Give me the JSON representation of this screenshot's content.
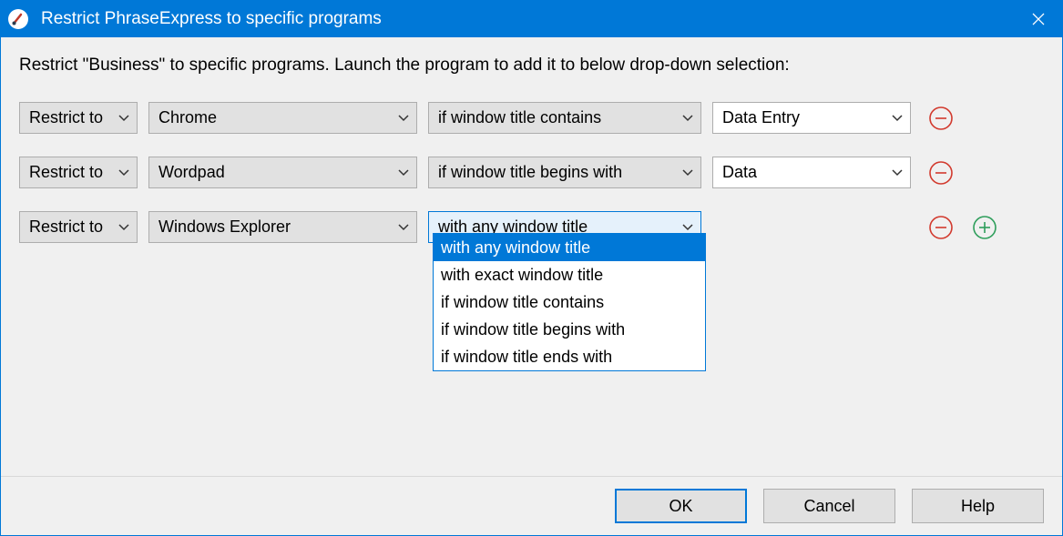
{
  "title": "Restrict PhraseExpress to specific programs",
  "instruction": "Restrict \"Business\" to specific programs. Launch the program to add it to below drop-down selection:",
  "rows": [
    {
      "action": "Restrict to",
      "program": "Chrome",
      "condition": "if window title contains",
      "title_value": "Data Entry"
    },
    {
      "action": "Restrict to",
      "program": "Wordpad",
      "condition": "if window title begins with",
      "title_value": "Data"
    },
    {
      "action": "Restrict to",
      "program": "Windows Explorer",
      "condition": "with any window title",
      "title_value": ""
    }
  ],
  "condition_options": [
    "with any window title",
    "with exact window title",
    "if window title contains",
    "if window title begins with",
    "if window title ends with"
  ],
  "buttons": {
    "ok": "OK",
    "cancel": "Cancel",
    "help": "Help"
  }
}
